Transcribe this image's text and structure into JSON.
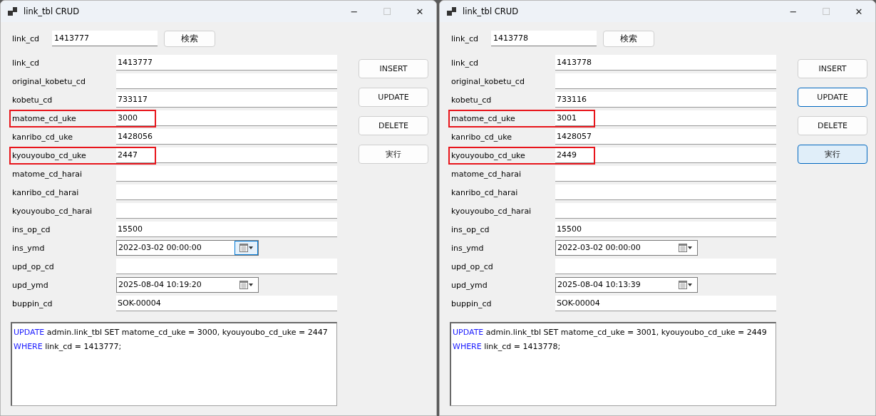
{
  "windows": [
    {
      "title": "link_tbl CRUD",
      "controls": {
        "minimize": "−",
        "maximize": "☐",
        "close": "✕"
      },
      "search": {
        "label": "link_cd",
        "value": "1413777",
        "button": "検索"
      },
      "fields": [
        {
          "label": "link_cd",
          "value": "1413777",
          "kind": "text",
          "highlighted": false
        },
        {
          "label": "original_kobetu_cd",
          "kind": "text",
          "highlighted": false
        },
        {
          "label": "kobetu_cd",
          "value": "733117",
          "kind": "text",
          "highlighted": false
        },
        {
          "label": "matome_cd_uke",
          "value": "3000",
          "kind": "text",
          "highlighted": true
        },
        {
          "label": "kanribo_cd_uke",
          "value": "1428056",
          "kind": "text",
          "highlighted": false
        },
        {
          "label": "kyouyoubo_cd_uke",
          "value": "2447",
          "kind": "text",
          "highlighted": true
        },
        {
          "label": "matome_cd_harai",
          "kind": "text",
          "highlighted": false
        },
        {
          "label": "kanribo_cd_harai",
          "kind": "text",
          "highlighted": false
        },
        {
          "label": "kyouyoubo_cd_harai",
          "kind": "text",
          "highlighted": false
        },
        {
          "label": "ins_op_cd",
          "value": "15500",
          "kind": "text",
          "highlighted": false
        },
        {
          "label": "ins_ymd",
          "value": "2022-03-02 00:00:00",
          "kind": "datetime",
          "highlighted": false,
          "dropdown_focused": true
        },
        {
          "label": "upd_op_cd",
          "kind": "text",
          "highlighted": false
        },
        {
          "label": "upd_ymd",
          "value": "2025-08-04 10:19:20",
          "kind": "datetime",
          "highlighted": false,
          "dropdown_focused": false
        },
        {
          "label": "buppin_cd",
          "value": "SOK-00004",
          "kind": "text",
          "highlighted": false
        }
      ],
      "buttons": [
        {
          "label": "INSERT",
          "focused": false,
          "hovered": false
        },
        {
          "label": "UPDATE",
          "focused": false,
          "hovered": false
        },
        {
          "label": "DELETE",
          "focused": false,
          "hovered": false
        },
        {
          "label": "実行",
          "focused": false,
          "hovered": false
        }
      ],
      "sql": [
        [
          {
            "text": "UPDATE",
            "kind": "keyword"
          },
          {
            "text": " admin.link_tbl SET matome_cd_uke = 3000, kyouyoubo_cd_uke = 2447",
            "kind": "plain"
          }
        ],
        [
          {
            "text": "WHERE",
            "kind": "keyword"
          },
          {
            "text": " link_cd = 1413777;",
            "kind": "plain"
          }
        ]
      ]
    },
    {
      "title": "link_tbl CRUD",
      "controls": {
        "minimize": "−",
        "maximize": "☐",
        "close": "✕"
      },
      "search": {
        "label": "link_cd",
        "value": "1413778",
        "button": "検索"
      },
      "fields": [
        {
          "label": "link_cd",
          "value": "1413778",
          "kind": "text",
          "highlighted": false
        },
        {
          "label": "original_kobetu_cd",
          "kind": "text",
          "highlighted": false
        },
        {
          "label": "kobetu_cd",
          "value": "733116",
          "kind": "text",
          "highlighted": false
        },
        {
          "label": "matome_cd_uke",
          "value": "3001",
          "kind": "text",
          "highlighted": true
        },
        {
          "label": "kanribo_cd_uke",
          "value": "1428057",
          "kind": "text",
          "highlighted": false
        },
        {
          "label": "kyouyoubo_cd_uke",
          "value": "2449",
          "kind": "text",
          "highlighted": true
        },
        {
          "label": "matome_cd_harai",
          "kind": "text",
          "highlighted": false
        },
        {
          "label": "kanribo_cd_harai",
          "kind": "text",
          "highlighted": false
        },
        {
          "label": "kyouyoubo_cd_harai",
          "kind": "text",
          "highlighted": false
        },
        {
          "label": "ins_op_cd",
          "value": "15500",
          "kind": "text",
          "highlighted": false
        },
        {
          "label": "ins_ymd",
          "value": "2022-03-02 00:00:00",
          "kind": "datetime",
          "highlighted": false,
          "dropdown_focused": false
        },
        {
          "label": "upd_op_cd",
          "kind": "text",
          "highlighted": false
        },
        {
          "label": "upd_ymd",
          "value": "2025-08-04 10:13:39",
          "kind": "datetime",
          "highlighted": false,
          "dropdown_focused": false
        },
        {
          "label": "buppin_cd",
          "value": "SOK-00004",
          "kind": "text",
          "highlighted": false
        }
      ],
      "buttons": [
        {
          "label": "INSERT",
          "focused": false,
          "hovered": false
        },
        {
          "label": "UPDATE",
          "focused": true,
          "hovered": false
        },
        {
          "label": "DELETE",
          "focused": false,
          "hovered": false
        },
        {
          "label": "実行",
          "focused": false,
          "hovered": true
        }
      ],
      "sql": [
        [
          {
            "text": "UPDATE",
            "kind": "keyword"
          },
          {
            "text": " admin.link_tbl SET matome_cd_uke = 3001, kyouyoubo_cd_uke = 2449",
            "kind": "plain"
          }
        ],
        [
          {
            "text": "WHERE",
            "kind": "keyword"
          },
          {
            "text": " link_cd = 1413778;",
            "kind": "plain"
          }
        ]
      ]
    }
  ]
}
